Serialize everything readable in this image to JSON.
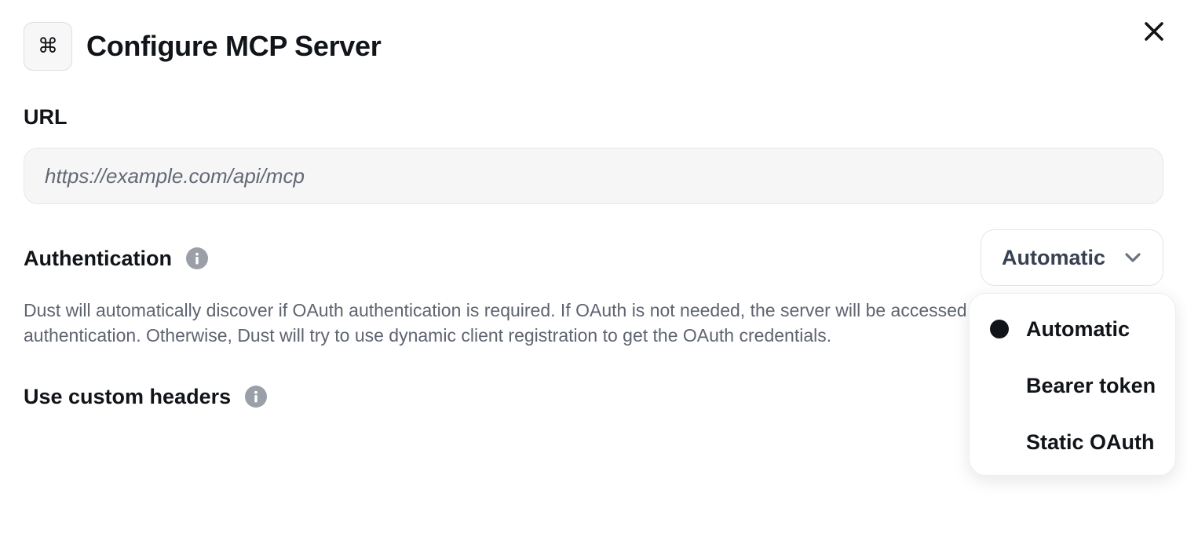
{
  "dialog": {
    "title": "Configure MCP Server",
    "icon": "command-key-icon",
    "close_icon": "close-icon"
  },
  "url": {
    "label": "URL",
    "value": "",
    "placeholder": "https://example.com/api/mcp"
  },
  "authentication": {
    "label": "Authentication",
    "info_icon": "info-icon",
    "selected": "Automatic",
    "description_line1": "Dust will automatically discover if OAuth authentication is required. If OAuth is not needed, the server will be accessed without",
    "description_line2": "authentication. Otherwise, Dust will try to use dynamic client registration to get the OAuth credentials.",
    "options": [
      {
        "label": "Automatic",
        "selected": true
      },
      {
        "label": "Bearer token",
        "selected": false
      },
      {
        "label": "Static OAuth",
        "selected": false
      }
    ]
  },
  "custom_headers": {
    "label": "Use custom headers",
    "info_icon": "info-icon"
  },
  "colors": {
    "text": "#111418",
    "muted_text": "#5e6470",
    "input_bg": "#f6f6f7",
    "info_icon": "#9a9fa8"
  }
}
